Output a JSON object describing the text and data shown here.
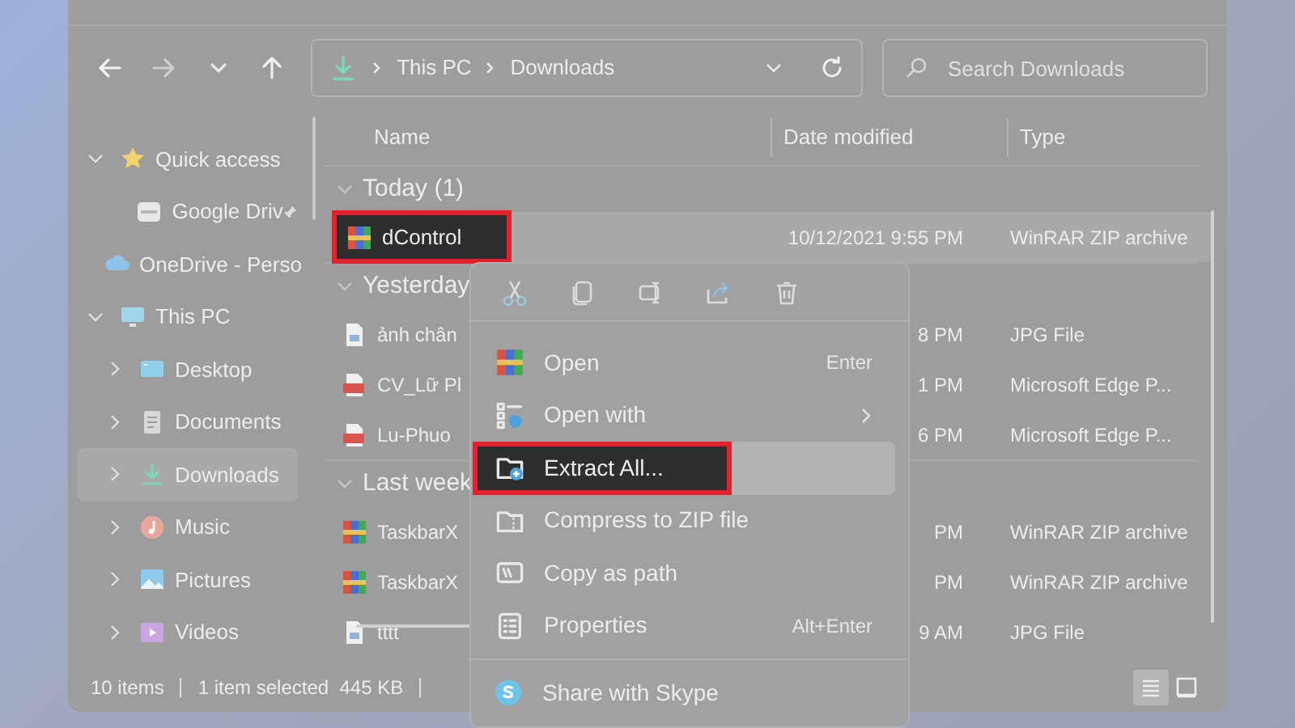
{
  "toolbar": {
    "address": [
      "This PC",
      "Downloads"
    ],
    "search": {
      "placeholder": "Search Downloads"
    }
  },
  "sidebar": {
    "items": [
      {
        "label": "Quick access",
        "kind": "star",
        "expanded": true,
        "selected": false,
        "children": [
          {
            "label": "Google Driv",
            "kind": "drive",
            "pinned": true,
            "selected": false
          }
        ]
      },
      {
        "label": "OneDrive - Perso",
        "kind": "cloud",
        "expanded": false,
        "selected": false
      },
      {
        "label": "This PC",
        "kind": "pc",
        "expanded": true,
        "selected": false,
        "children": [
          {
            "label": "Desktop",
            "kind": "desktop",
            "expanded": false,
            "selected": false
          },
          {
            "label": "Documents",
            "kind": "documents",
            "expanded": false,
            "selected": false
          },
          {
            "label": "Downloads",
            "kind": "downloads",
            "expanded": false,
            "selected": true
          },
          {
            "label": "Music",
            "kind": "music",
            "expanded": false,
            "selected": false
          },
          {
            "label": "Pictures",
            "kind": "pictures",
            "expanded": false,
            "selected": false
          },
          {
            "label": "Videos",
            "kind": "videos",
            "expanded": false,
            "selected": false
          }
        ]
      }
    ]
  },
  "columns": [
    "Name",
    "Date modified",
    "Type"
  ],
  "groups": [
    {
      "label": "Today (1)",
      "files": [
        {
          "name": "dControl",
          "date": "10/12/2021 9:55 PM",
          "type": "WinRAR ZIP archive",
          "kind": "archive",
          "selected": true,
          "outlined": true
        }
      ]
    },
    {
      "label": "Yesterday",
      "files": [
        {
          "name": "ảnh chân",
          "date": "8 PM",
          "type": "JPG File",
          "kind": "image",
          "selected": false,
          "outlined": false
        },
        {
          "name": "CV_Lữ Pl",
          "date": "1 PM",
          "type": "Microsoft Edge P...",
          "kind": "pdf",
          "selected": false,
          "outlined": false
        },
        {
          "name": "Lu-Phuo",
          "date": "6 PM",
          "type": "Microsoft Edge P...",
          "kind": "pdf",
          "selected": false,
          "outlined": false
        }
      ]
    },
    {
      "label": "Last week",
      "files": [
        {
          "name": "TaskbarX",
          "date": "PM",
          "type": "WinRAR ZIP archive",
          "kind": "archive",
          "selected": false,
          "outlined": false
        },
        {
          "name": "TaskbarX",
          "date": "PM",
          "type": "WinRAR ZIP archive",
          "kind": "archive",
          "selected": false,
          "outlined": false
        },
        {
          "name": "tttt",
          "date": "9 AM",
          "type": "JPG File",
          "kind": "image",
          "selected": false,
          "outlined": false
        }
      ]
    }
  ],
  "context_menu": {
    "items": [
      {
        "label": "Open",
        "kind": "archive",
        "shortcut": "Enter",
        "submenu": false,
        "selected": false,
        "outlined": false
      },
      {
        "label": "Open with",
        "kind": "openwith",
        "submenu": true,
        "selected": false,
        "outlined": false
      },
      {
        "label": "Extract All...",
        "kind": "extract",
        "submenu": false,
        "selected": true,
        "outlined": true
      },
      {
        "label": "Compress to ZIP file",
        "kind": "zip",
        "submenu": false,
        "selected": false,
        "outlined": false
      },
      {
        "label": "Copy as path",
        "kind": "path",
        "submenu": false,
        "selected": false,
        "outlined": false
      },
      {
        "label": "Properties",
        "kind": "properties",
        "shortcut": "Alt+Enter",
        "submenu": false,
        "selected": false,
        "outlined": false
      }
    ],
    "footer_items": [
      {
        "label": "Share with Skype",
        "kind": "skype"
      }
    ]
  },
  "status_bar": {
    "count": "10 items",
    "selection": "1 item selected  445 KB",
    "views": [
      {
        "kind": "details",
        "selected": true
      },
      {
        "kind": "tiles",
        "selected": false
      }
    ]
  }
}
